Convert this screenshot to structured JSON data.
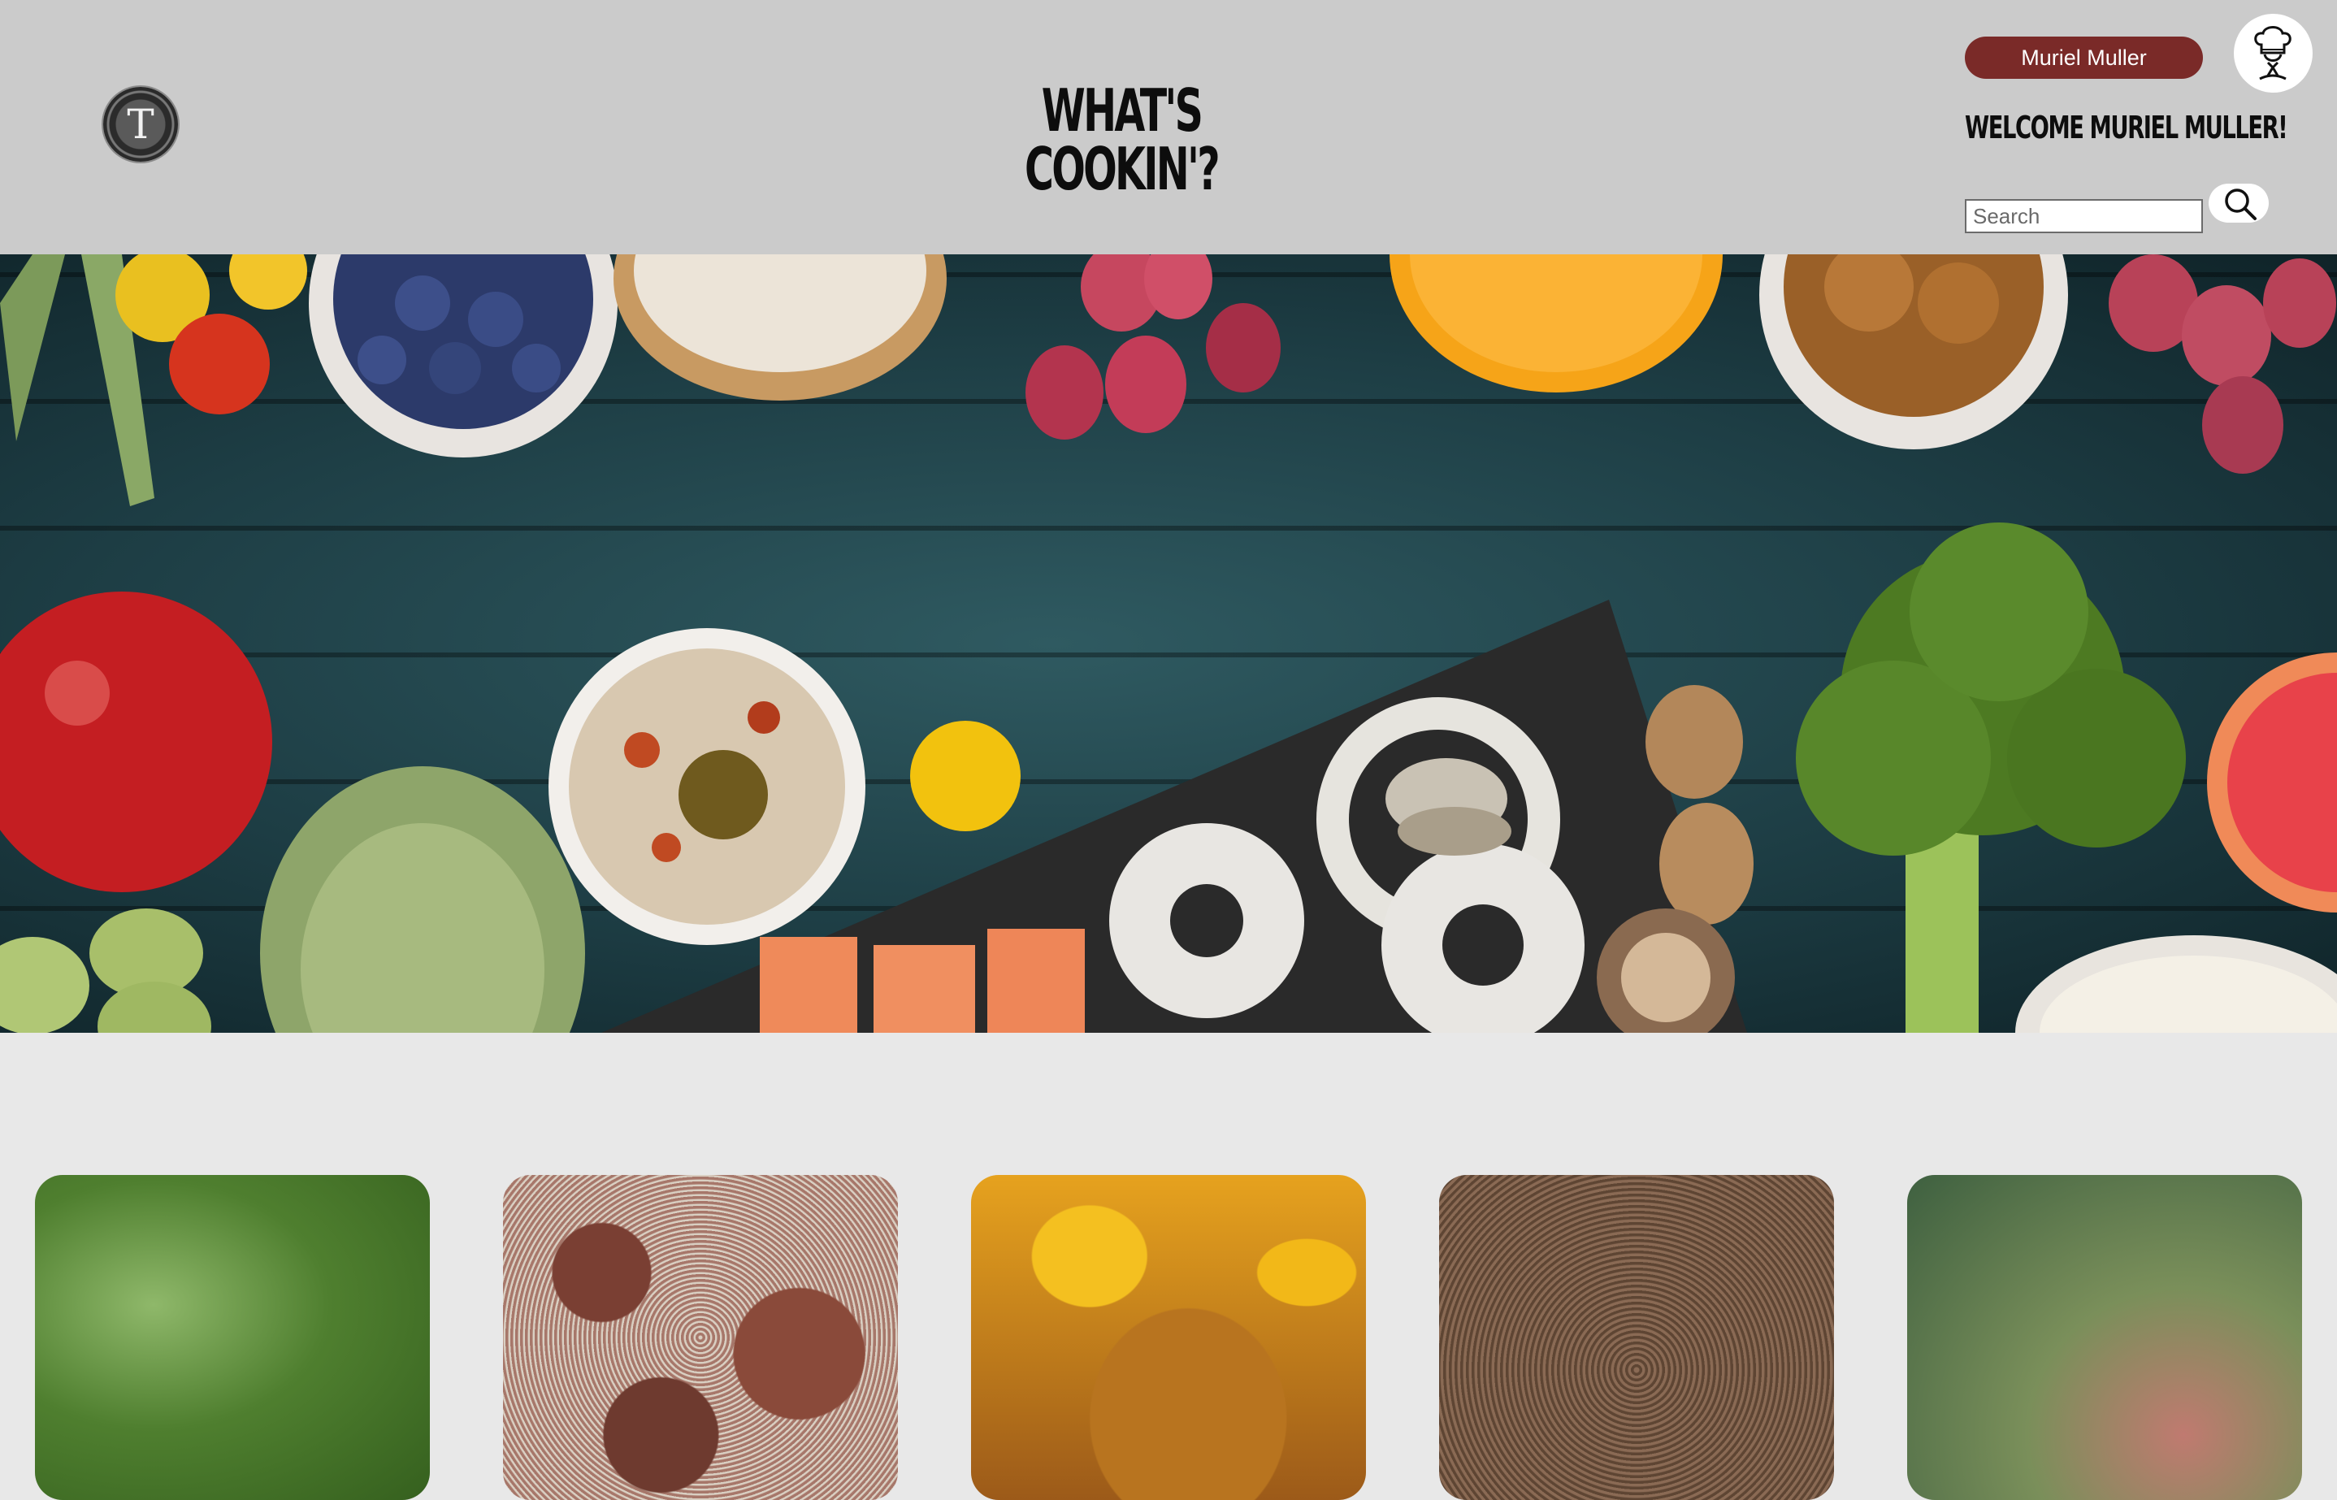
{
  "header": {
    "logo_letter": "T",
    "title": "WHAT'S COOKIN'?",
    "user_button_label": "Muriel Muller",
    "welcome_text": "WELCOME MURIEL MULLER!",
    "search_placeholder": "Search"
  },
  "icons": {
    "logo": "logo-icon",
    "chef": "chef-hat-icon",
    "search": "search-icon"
  },
  "colors": {
    "header_bg": "#cbcbcb",
    "page_bg": "#e8e8e8",
    "accent": "#7a2a28",
    "hero_table": "#1d3d44"
  },
  "recipe_cards": [
    {
      "image": "leafy-greens"
    },
    {
      "image": "meatballs-with-parmesan"
    },
    {
      "image": "glazed-chicken-with-peaches"
    },
    {
      "image": "grilled-bread-crust"
    },
    {
      "image": "blurred-salad"
    }
  ]
}
